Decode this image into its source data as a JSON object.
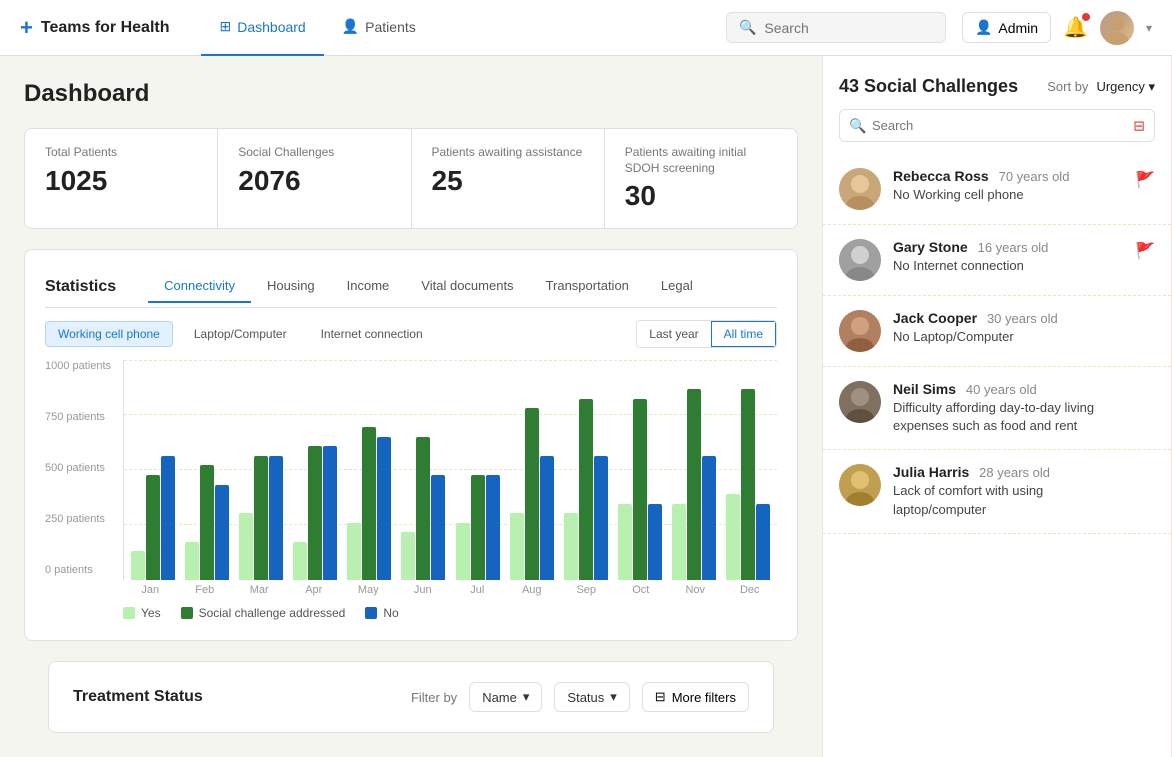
{
  "brand": {
    "name": "Teams for Health",
    "icon": "+"
  },
  "nav": {
    "links": [
      {
        "label": "Dashboard",
        "icon": "⊞",
        "active": true
      },
      {
        "label": "Patients",
        "icon": "👤",
        "active": false
      }
    ],
    "search_placeholder": "Search",
    "admin_label": "Admin",
    "admin_icon": "👤"
  },
  "dashboard": {
    "title": "Dashboard",
    "stats": [
      {
        "label": "Total Patients",
        "value": "1025"
      },
      {
        "label": "Social Challenges",
        "value": "2076"
      },
      {
        "label": "Patients awaiting assistance",
        "value": "25"
      },
      {
        "label": "Patients awaiting initial SDOH screening",
        "value": "30"
      }
    ]
  },
  "statistics": {
    "title": "Statistics",
    "tabs": [
      "Connectivity",
      "Housing",
      "Income",
      "Vital documents",
      "Transportation",
      "Legal"
    ],
    "active_tab": "Connectivity",
    "sub_tabs": [
      "Working cell phone",
      "Laptop/Computer",
      "Internet connection"
    ],
    "active_sub_tab": "Working cell phone",
    "time_filters": [
      "Last year",
      "All time"
    ],
    "active_time": "All time",
    "y_labels": [
      "1000 patients",
      "750 patients",
      "500 patients",
      "250 patients",
      "0 patients"
    ],
    "x_labels": [
      "Jan",
      "Feb",
      "Mar",
      "Apr",
      "May",
      "Jun",
      "Jul",
      "Aug",
      "Sep",
      "Oct",
      "Nov",
      "Dec"
    ],
    "legend": [
      {
        "label": "Yes",
        "color": "#b8f0b0"
      },
      {
        "label": "Social challenge addressed",
        "color": "#2e7d32"
      },
      {
        "label": "No",
        "color": "#1565c0"
      }
    ],
    "bars": [
      {
        "yes": 15,
        "addressed": 55,
        "no": 65
      },
      {
        "yes": 20,
        "addressed": 60,
        "no": 50
      },
      {
        "yes": 35,
        "addressed": 65,
        "no": 65
      },
      {
        "yes": 20,
        "addressed": 70,
        "no": 70
      },
      {
        "yes": 30,
        "addressed": 80,
        "no": 75
      },
      {
        "yes": 25,
        "addressed": 75,
        "no": 55
      },
      {
        "yes": 30,
        "addressed": 55,
        "no": 55
      },
      {
        "yes": 35,
        "addressed": 90,
        "no": 65
      },
      {
        "yes": 35,
        "addressed": 95,
        "no": 65
      },
      {
        "yes": 40,
        "addressed": 95,
        "no": 40
      },
      {
        "yes": 40,
        "addressed": 100,
        "no": 65
      },
      {
        "yes": 45,
        "addressed": 100,
        "no": 40
      }
    ]
  },
  "social_challenges": {
    "title": "43 Social Challenges",
    "sort_label": "Sort by",
    "sort_value": "Urgency",
    "search_placeholder": "Search",
    "patients": [
      {
        "name": "Rebecca Ross",
        "age": "70 years old",
        "challenge": "No Working cell phone",
        "flagged": true,
        "av_class": "av-1"
      },
      {
        "name": "Gary Stone",
        "age": "16 years old",
        "challenge": "No Internet connection",
        "flagged": true,
        "av_class": "av-2"
      },
      {
        "name": "Jack Cooper",
        "age": "30 years old",
        "challenge": "No Laptop/Computer",
        "flagged": false,
        "av_class": "av-3"
      },
      {
        "name": "Neil Sims",
        "age": "40 years old",
        "challenge": "Difficulty affording day-to-day living expenses such as food and rent",
        "flagged": false,
        "av_class": "av-4"
      },
      {
        "name": "Julia Harris",
        "age": "28 years old",
        "challenge": "Lack of comfort with using laptop/computer",
        "flagged": false,
        "av_class": "av-5"
      }
    ]
  },
  "treatment": {
    "title": "Treatment Status",
    "filter_label": "Filter by",
    "filter_name": "Name",
    "filter_status": "Status",
    "more_filters": "More filters"
  }
}
